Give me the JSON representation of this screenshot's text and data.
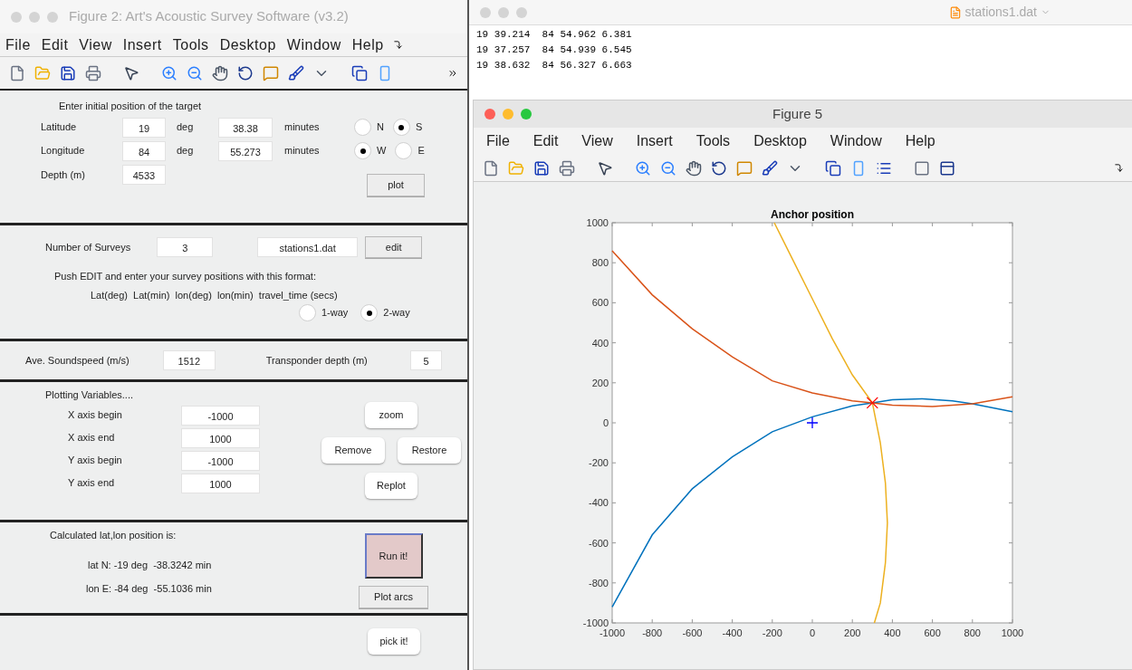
{
  "survey_window": {
    "title": "Figure 2: Art's Acoustic Survey Software (v3.2)",
    "active": false,
    "menu": [
      "File",
      "Edit",
      "View",
      "Insert",
      "Tools",
      "Desktop",
      "Window",
      "Help"
    ],
    "target": {
      "heading": "Enter initial position of the target",
      "rows": [
        {
          "label": "Latitude",
          "deg": "19",
          "deg_unit": "deg",
          "minutes": "38.38",
          "min_unit": "minutes",
          "options": [
            {
              "label": "N",
              "selected": false
            },
            {
              "label": "S",
              "selected": true
            }
          ]
        },
        {
          "label": "Longitude",
          "deg": "84",
          "deg_unit": "deg",
          "minutes": "55.273",
          "min_unit": "minutes",
          "options": [
            {
              "label": "W",
              "selected": true
            },
            {
              "label": "E",
              "selected": false
            }
          ]
        }
      ],
      "depth": {
        "label": "Depth (m)",
        "value": "4533"
      },
      "plot_button": "plot"
    },
    "surveys": {
      "label": "Number of Surveys",
      "count": "3",
      "file": "stations1.dat",
      "edit_button": "edit",
      "instruction": "Push EDIT and enter your survey positions with this format:",
      "format": "Lat(deg)  Lat(min)  lon(deg)  lon(min)  travel_time (secs)",
      "travel": [
        {
          "label": "1-way",
          "selected": false
        },
        {
          "label": "2-way",
          "selected": true
        }
      ]
    },
    "sound": {
      "label": "Ave. Soundspeed (m/s)",
      "value": "1512",
      "transponder_label": "Transponder depth (m)",
      "transponder_value": "5"
    },
    "plotting": {
      "heading": "Plotting Variables....",
      "fields": [
        {
          "label": "X axis begin",
          "value": "-1000"
        },
        {
          "label": "X axis end",
          "value": "1000"
        },
        {
          "label": "Y axis begin",
          "value": "-1000"
        },
        {
          "label": "Y axis end",
          "value": "1000"
        }
      ],
      "zoom_button": "zoom",
      "remove_button": "Remove",
      "restore_button": "Restore",
      "replot_button": "Replot"
    },
    "result": {
      "heading": "Calculated lat,lon position is:",
      "lat": "lat N: -19 deg  -38.3242 min",
      "lon": "lon E: -84 deg  -55.1036 min",
      "run_button": "Run it!",
      "arcs_button": "Plot arcs"
    },
    "pick_button": "pick it!"
  },
  "editor_window": {
    "title": "stations1.dat",
    "active": false,
    "lines": [
      "19 39.214  84 54.962 6.381",
      "19 37.257  84 54.939 6.545",
      "19 38.632  84 56.327 6.663"
    ]
  },
  "figure_window": {
    "title": "Figure 5",
    "active": true,
    "menu": [
      "File",
      "Edit",
      "View",
      "Insert",
      "Tools",
      "Desktop",
      "Window",
      "Help"
    ],
    "chart_data": {
      "type": "line",
      "title": "Anchor position",
      "xlim": [
        -1000,
        1000
      ],
      "ylim": [
        -1000,
        1000
      ],
      "xticks": [
        -1000,
        -800,
        -600,
        -400,
        -200,
        0,
        200,
        400,
        600,
        800,
        1000
      ],
      "yticks": [
        -1000,
        -800,
        -600,
        -400,
        -200,
        0,
        200,
        400,
        600,
        800,
        1000
      ],
      "series": [
        {
          "color": "#0072bd",
          "x": [
            -1000,
            -800,
            -600,
            -400,
            -200,
            0,
            200,
            300,
            400,
            550,
            700,
            800,
            1000
          ],
          "values": [
            -920,
            -560,
            -330,
            -170,
            -45,
            30,
            85,
            100,
            115,
            120,
            110,
            95,
            55
          ]
        },
        {
          "color": "#d95319",
          "x": [
            -1000,
            -800,
            -600,
            -400,
            -200,
            0,
            200,
            300,
            400,
            600,
            800,
            1000
          ],
          "values": [
            860,
            640,
            470,
            330,
            210,
            150,
            110,
            100,
            88,
            82,
            95,
            130
          ]
        },
        {
          "color": "#edb120",
          "x": [
            -190,
            -100,
            0,
            100,
            200,
            300,
            340,
            365,
            375,
            365,
            340,
            310
          ],
          "values": [
            1000,
            820,
            620,
            420,
            240,
            100,
            -100,
            -300,
            -500,
            -700,
            -900,
            -1000
          ]
        }
      ]
    }
  }
}
